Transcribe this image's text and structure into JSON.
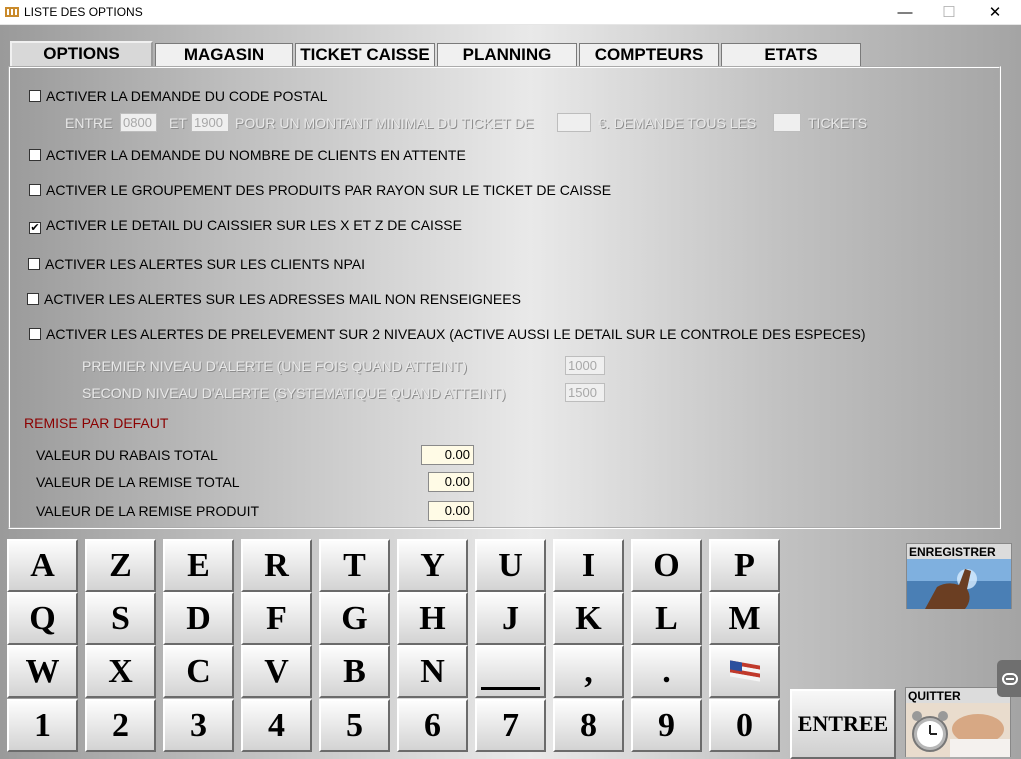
{
  "window": {
    "title": "LISTE DES OPTIONS",
    "minimize": "—",
    "maximize": "☐",
    "close": "✕"
  },
  "tabs": [
    "OPTIONS",
    "MAGASIN",
    "TICKET CAISSE",
    "PLANNING",
    "COMPTEURS",
    "ETATS"
  ],
  "active_tab": "OPTIONS",
  "options": {
    "code_postal": {
      "label": "ACTIVER LA DEMANDE DU CODE POSTAL",
      "checked": false
    },
    "code_postal_detail": {
      "entre": "ENTRE",
      "from": "0800",
      "et": "ET",
      "to": "1900",
      "montant_text": "POUR UN MONTANT MINIMAL DU TICKET DE",
      "montant": "",
      "euro_text": "€. DEMANDE TOUS LES",
      "tickets_value": "",
      "tickets_text": "TICKETS"
    },
    "clients_attente": {
      "label": "ACTIVER LA DEMANDE DU NOMBRE DE CLIENTS EN ATTENTE",
      "checked": false
    },
    "groupement_rayon": {
      "label": "ACTIVER LE GROUPEMENT DES PRODUITS PAR RAYON SUR LE TICKET DE CAISSE",
      "checked": false
    },
    "detail_caissier": {
      "label": "ACTIVER LE DETAIL DU CAISSIER SUR LES X ET Z DE CAISSE",
      "checked": true
    },
    "alertes_npai": {
      "label": "ACTIVER LES ALERTES SUR LES CLIENTS NPAI",
      "checked": false
    },
    "alertes_mail": {
      "label": "ACTIVER LES ALERTES SUR LES ADRESSES MAIL NON RENSEIGNEES",
      "checked": false
    },
    "alertes_prelevement": {
      "label": "ACTIVER LES ALERTES DE PRELEVEMENT SUR 2 NIVEAUX (ACTIVE AUSSI LE DETAIL SUR LE CONTROLE DES ESPECES)",
      "checked": false
    },
    "premier_niveau": {
      "label": "PREMIER NIVEAU D'ALERTE (UNE FOIS QUAND ATTEINT)",
      "value": "1000"
    },
    "second_niveau": {
      "label": "SECOND NIVEAU D'ALERTE (SYSTEMATIQUE QUAND ATTEINT)",
      "value": "1500"
    }
  },
  "remise": {
    "title": "REMISE PAR DEFAUT",
    "rabais_total": {
      "label": "VALEUR DU RABAIS TOTAL",
      "value": "0.00"
    },
    "remise_total": {
      "label": "VALEUR DE LA REMISE TOTAL",
      "value": "0.00"
    },
    "remise_produit": {
      "label": "VALEUR DE LA REMISE PRODUIT",
      "value": "0.00"
    }
  },
  "keyboard": {
    "row1": [
      "A",
      "Z",
      "E",
      "R",
      "T",
      "Y",
      "U",
      "I",
      "O",
      "P"
    ],
    "row2": [
      "Q",
      "S",
      "D",
      "F",
      "G",
      "H",
      "J",
      "K",
      "L",
      "M"
    ],
    "row3": [
      "W",
      "X",
      "C",
      "V",
      "B",
      "N",
      "",
      ",",
      ".",
      ""
    ],
    "row4": [
      "1",
      "2",
      "3",
      "4",
      "5",
      "6",
      "7",
      "8",
      "9",
      "0"
    ],
    "space_key": "space-key",
    "flag_key": "flag-icon"
  },
  "buttons": {
    "entree": "ENTREE",
    "enregistrer": "ENREGISTRER",
    "quitter": "QUITTER"
  }
}
